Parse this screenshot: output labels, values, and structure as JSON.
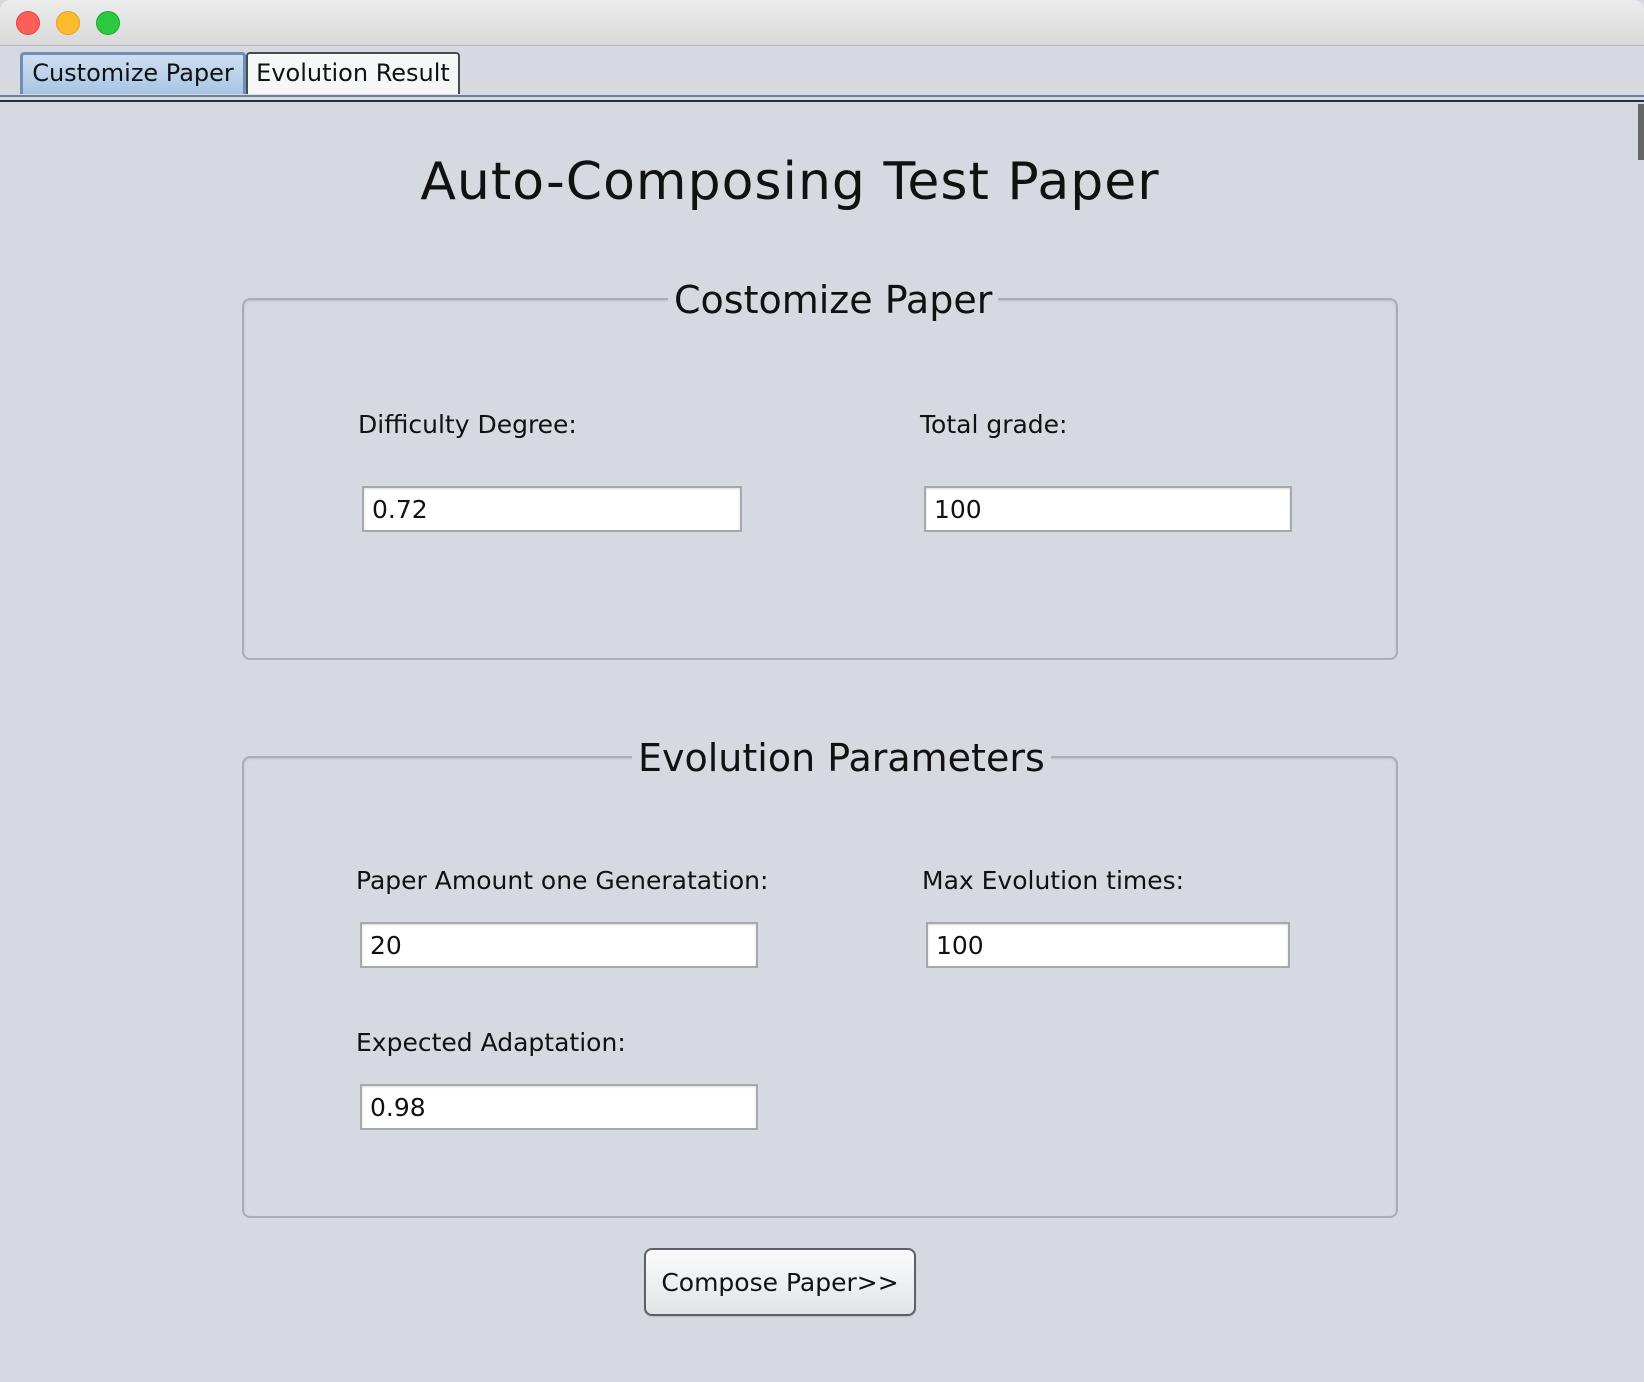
{
  "window": {
    "controls": [
      "close-button",
      "minimize-button",
      "maximize-button"
    ]
  },
  "tabs": [
    {
      "label": "Customize Paper",
      "active": true
    },
    {
      "label": "Evolution Result",
      "active": false
    }
  ],
  "main": {
    "title": "Auto-Composing Test Paper"
  },
  "customize_group": {
    "title": "Costomize Paper",
    "difficulty_label": "Difficulty Degree:",
    "difficulty_value": "0.72",
    "total_grade_label": "Total grade:",
    "total_grade_value": "100"
  },
  "evolution_group": {
    "title": "Evolution Parameters",
    "paper_amount_label": "Paper Amount one Generatation:",
    "paper_amount_value": "20",
    "max_evolution_label": "Max Evolution times:",
    "max_evolution_value": "100",
    "expected_adaptation_label": "Expected Adaptation:",
    "expected_adaptation_value": "0.98"
  },
  "actions": {
    "compose_label": "Compose Paper>>"
  },
  "colors": {
    "background": "#d6d9e0",
    "tab_active": "#a8c5e4",
    "close": "#fc5f57",
    "minimize": "#fdbb2e",
    "maximize": "#2ac940"
  }
}
